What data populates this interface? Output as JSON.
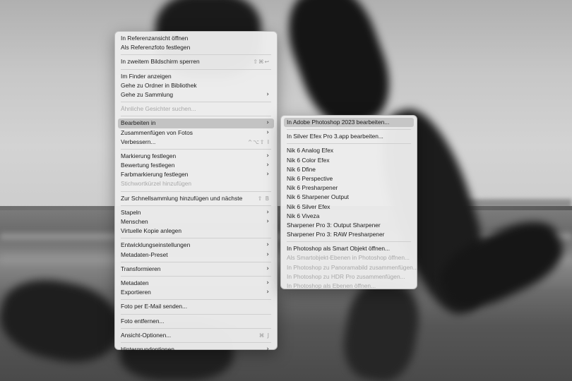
{
  "main_menu": {
    "items": [
      {
        "label": "In Referenzansicht öffnen",
        "shortcut": "",
        "submenu": false,
        "disabled": false,
        "active": false
      },
      {
        "label": "Als Referenzfoto festlegen",
        "shortcut": "",
        "submenu": false,
        "disabled": false,
        "active": false
      },
      {
        "sep": true
      },
      {
        "label": "In zweitem Bildschirm sperren",
        "shortcut": "⇧⌘↩",
        "submenu": false,
        "disabled": false,
        "active": false
      },
      {
        "sep": true
      },
      {
        "label": "Im Finder anzeigen",
        "shortcut": "",
        "submenu": false,
        "disabled": false,
        "active": false
      },
      {
        "label": "Gehe zu Ordner in Bibliothek",
        "shortcut": "",
        "submenu": false,
        "disabled": false,
        "active": false
      },
      {
        "label": "Gehe zu Sammlung",
        "shortcut": "",
        "submenu": true,
        "disabled": false,
        "active": false
      },
      {
        "sep": true
      },
      {
        "label": "Ähnliche Gesichter suchen...",
        "shortcut": "",
        "submenu": false,
        "disabled": true,
        "active": false
      },
      {
        "sep": true
      },
      {
        "label": "Bearbeiten in",
        "shortcut": "",
        "submenu": true,
        "disabled": false,
        "active": true
      },
      {
        "label": "Zusammenfügen von Fotos",
        "shortcut": "",
        "submenu": true,
        "disabled": false,
        "active": false
      },
      {
        "label": "Verbessern...",
        "shortcut": "^⌥⇧ I",
        "submenu": false,
        "disabled": false,
        "active": false
      },
      {
        "sep": true
      },
      {
        "label": "Markierung festlegen",
        "shortcut": "",
        "submenu": true,
        "disabled": false,
        "active": false
      },
      {
        "label": "Bewertung festlegen",
        "shortcut": "",
        "submenu": true,
        "disabled": false,
        "active": false
      },
      {
        "label": "Farbmarkierung festlegen",
        "shortcut": "",
        "submenu": true,
        "disabled": false,
        "active": false
      },
      {
        "label": "Stichwortkürzel hinzufügen",
        "shortcut": "",
        "submenu": false,
        "disabled": true,
        "active": false
      },
      {
        "sep": true
      },
      {
        "label": "Zur Schnellsammlung hinzufügen und nächste",
        "shortcut": "⇧ B",
        "submenu": false,
        "disabled": false,
        "active": false
      },
      {
        "sep": true
      },
      {
        "label": "Stapeln",
        "shortcut": "",
        "submenu": true,
        "disabled": false,
        "active": false
      },
      {
        "label": "Menschen",
        "shortcut": "",
        "submenu": true,
        "disabled": false,
        "active": false
      },
      {
        "label": "Virtuelle Kopie anlegen",
        "shortcut": "",
        "submenu": false,
        "disabled": false,
        "active": false
      },
      {
        "sep": true
      },
      {
        "label": "Entwicklungseinstellungen",
        "shortcut": "",
        "submenu": true,
        "disabled": false,
        "active": false
      },
      {
        "label": "Metadaten-Preset",
        "shortcut": "",
        "submenu": true,
        "disabled": false,
        "active": false
      },
      {
        "sep": true
      },
      {
        "label": "Transformieren",
        "shortcut": "",
        "submenu": true,
        "disabled": false,
        "active": false
      },
      {
        "sep": true
      },
      {
        "label": "Metadaten",
        "shortcut": "",
        "submenu": true,
        "disabled": false,
        "active": false
      },
      {
        "label": "Exportieren",
        "shortcut": "",
        "submenu": true,
        "disabled": false,
        "active": false
      },
      {
        "sep": true
      },
      {
        "label": "Foto per E-Mail senden...",
        "shortcut": "",
        "submenu": false,
        "disabled": false,
        "active": false
      },
      {
        "sep": true
      },
      {
        "label": "Foto entfernen...",
        "shortcut": "",
        "submenu": false,
        "disabled": false,
        "active": false
      },
      {
        "sep": true
      },
      {
        "label": "Ansicht-Optionen...",
        "shortcut": "⌘ J",
        "submenu": false,
        "disabled": false,
        "active": false
      },
      {
        "sep": true
      },
      {
        "label": "Hintergrundoptionen",
        "shortcut": "",
        "submenu": true,
        "disabled": false,
        "active": false
      }
    ]
  },
  "sub_menu": {
    "items": [
      {
        "label": "In Adobe Photoshop 2023 bearbeiten...",
        "disabled": false,
        "active": true
      },
      {
        "sep": true
      },
      {
        "label": "In Silver Efex Pro 3.app bearbeiten...",
        "disabled": false,
        "active": false
      },
      {
        "sep": true
      },
      {
        "label": "Nik 6 Analog Efex",
        "disabled": false,
        "active": false
      },
      {
        "label": "Nik 6 Color Efex",
        "disabled": false,
        "active": false
      },
      {
        "label": "Nik 6 Dfine",
        "disabled": false,
        "active": false
      },
      {
        "label": "Nik 6 Perspective",
        "disabled": false,
        "active": false
      },
      {
        "label": "Nik 6 Presharpener",
        "disabled": false,
        "active": false
      },
      {
        "label": "Nik 6 Sharpener Output",
        "disabled": false,
        "active": false
      },
      {
        "label": "Nik 6 Silver Efex",
        "disabled": false,
        "active": false
      },
      {
        "label": "Nik 6 Viveza",
        "disabled": false,
        "active": false
      },
      {
        "label": "Sharpener Pro 3: Output Sharpener",
        "disabled": false,
        "active": false
      },
      {
        "label": "Sharpener Pro 3: RAW Presharpener",
        "disabled": false,
        "active": false
      },
      {
        "sep": true
      },
      {
        "label": "In Photoshop als Smart Objekt öffnen...",
        "disabled": false,
        "active": false
      },
      {
        "label": "Als Smartobjekt-Ebenen in Photoshop öffnen...",
        "disabled": true,
        "active": false
      },
      {
        "label": "In Photoshop zu Panoramabild zusammenfügen...",
        "disabled": true,
        "active": false
      },
      {
        "label": "In Photoshop zu HDR Pro zusammenfügen...",
        "disabled": true,
        "active": false
      },
      {
        "label": "In Photoshop als Ebenen öffnen...",
        "disabled": true,
        "active": false
      }
    ]
  }
}
